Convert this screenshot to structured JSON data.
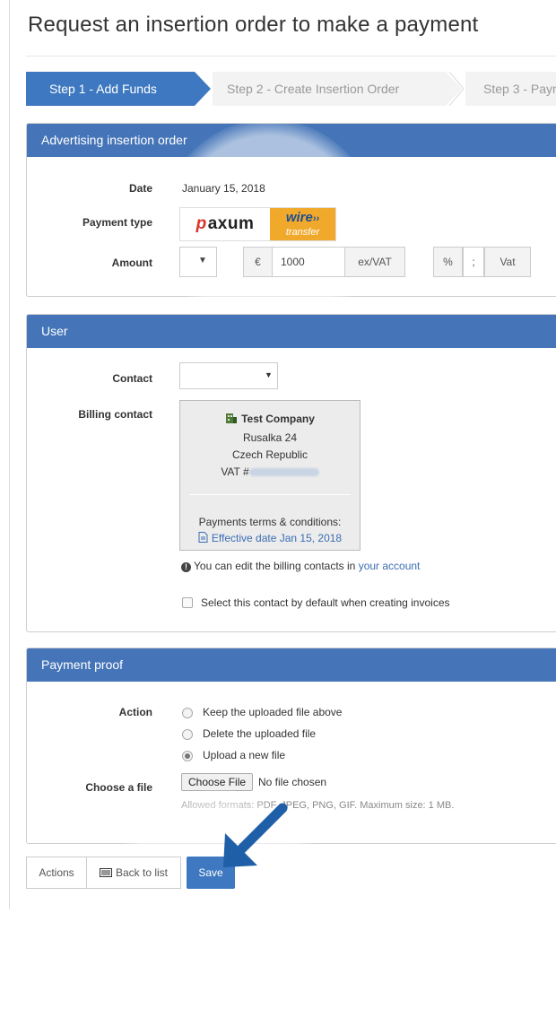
{
  "page": {
    "title": "Request an insertion order to make a payment"
  },
  "steps": [
    {
      "label": "Step 1 - Add Funds"
    },
    {
      "label": "Step 2 - Create Insertion Order"
    },
    {
      "label": "Step 3 - Paym"
    }
  ],
  "insertion_order": {
    "heading": "Advertising insertion order",
    "date_label": "Date",
    "date_value": "January 15, 2018",
    "payment_type_label": "Payment type",
    "payment_options": [
      {
        "name": "paxum",
        "logo_text": "paxum",
        "logo_initial": "p"
      },
      {
        "name": "wire transfer",
        "logo_text": "wire",
        "logo_sub": "transfer",
        "selected": true,
        "color": "#f1a92b"
      }
    ],
    "amount_label": "Amount",
    "amount_select_value": "",
    "currency_symbol": "€",
    "amount_value": "1000",
    "amount_suffix": "ex/VAT",
    "vat_percent_symbol": "%",
    "vat_separator": ";",
    "vat_label": "Vat"
  },
  "user": {
    "heading": "User",
    "contact_label": "Contact",
    "contact_select_value": "",
    "billing_label": "Billing contact",
    "billing": {
      "company": "Test Company",
      "street": "Rusalka 24",
      "country": "Czech Republic",
      "vat_prefix": "VAT #",
      "terms_label": "Payments terms & conditions:",
      "terms_link": "Effective date Jan 15, 2018"
    },
    "info_text": "You can edit the billing contacts in ",
    "info_link": "your account",
    "default_checkbox_label": "Select this contact by default when creating invoices"
  },
  "payment_proof": {
    "heading": "Payment proof",
    "action_label": "Action",
    "actions": [
      {
        "label": "Keep the uploaded file above",
        "checked": false
      },
      {
        "label": "Delete the uploaded file",
        "checked": false
      },
      {
        "label": "Upload a new file",
        "checked": true
      }
    ],
    "file_label": "Choose a file",
    "file_button": "Choose File",
    "file_status": "No file chosen",
    "file_help": "Allowed formats: PDF, JPEG, PNG, GIF. Maximum size: 1 MB."
  },
  "footer": {
    "actions_button": "Actions",
    "back_button": "Back to list",
    "save_button": "Save"
  },
  "colors": {
    "primary": "#3e78c0",
    "panel_header": "#4575b8",
    "link": "#3a6db3",
    "wire_orange": "#f1a92b",
    "arrow": "#1f5fa8"
  }
}
